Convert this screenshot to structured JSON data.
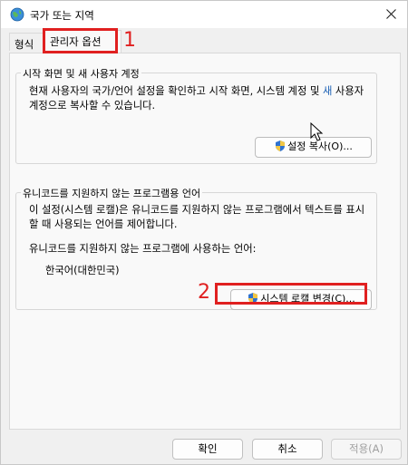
{
  "window": {
    "title": "국가 또는 지역"
  },
  "tabs": [
    {
      "label": "형식"
    },
    {
      "label": "관리자 옵션"
    }
  ],
  "annotations": {
    "marker1": "1",
    "marker2": "2",
    "color": "#e02020"
  },
  "welcome_group": {
    "legend": "시작 화면 및 새 사용자 계정",
    "desc_a": "현재 사용자의 국가/언어 설정을 확인하고 시작 화면, 시스템 계정 및 ",
    "desc_blue": "새",
    "desc_b": " 사용자 계정으로 복사할 수 있습니다.",
    "button": "설정 복사(O)..."
  },
  "unicode_group": {
    "legend": "유니코드를 지원하지 않는 프로그램용 언어",
    "desc": "이 설정(시스템 로캘)은 유니코드를 지원하지 않는 프로그램에서 텍스트를 표시할 때 사용되는 언어를 제어합니다.",
    "current_label": "유니코드를 지원하지 않는 프로그램에 사용하는 언어:",
    "current_value": "한국어(대한민국)",
    "button": "시스템 로캘 변경(C)..."
  },
  "footer": {
    "ok": "확인",
    "cancel": "취소",
    "apply": "적용(A)"
  },
  "icons": {
    "title": "globe-icon",
    "close": "close-icon",
    "shield": "uac-shield-icon",
    "cursor": "mouse-cursor-icon"
  }
}
